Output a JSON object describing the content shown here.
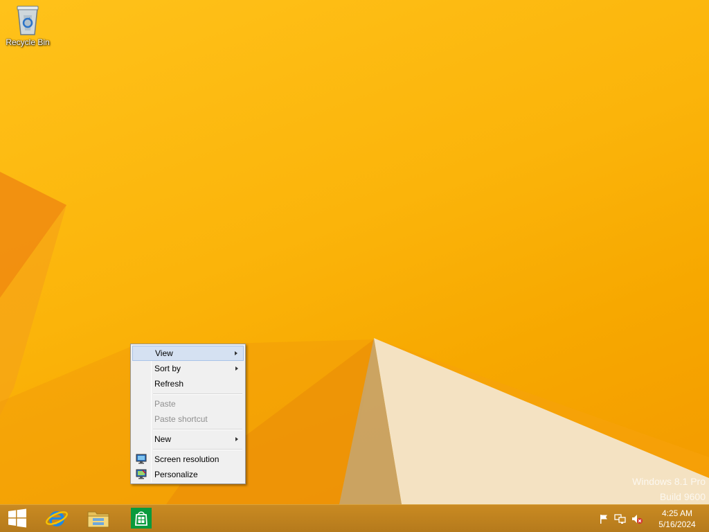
{
  "desktop": {
    "icons": [
      {
        "label": "Recycle Bin",
        "icon": "recycle-bin-icon"
      }
    ],
    "watermark": {
      "line1": "Windows 8.1 Pro",
      "line2": "Build 9600"
    }
  },
  "context_menu": {
    "items": [
      {
        "label": "View",
        "submenu": true,
        "highlighted": true
      },
      {
        "label": "Sort by",
        "submenu": true
      },
      {
        "label": "Refresh"
      },
      {
        "label": "Paste",
        "disabled": true
      },
      {
        "label": "Paste shortcut",
        "disabled": true
      },
      {
        "label": "New",
        "submenu": true
      },
      {
        "label": "Screen resolution",
        "icon": "display-settings-icon"
      },
      {
        "label": "Personalize",
        "icon": "personalize-icon"
      }
    ]
  },
  "taskbar": {
    "start": {
      "icon": "windows-start-icon"
    },
    "pinned": [
      {
        "name": "Internet Explorer",
        "icon": "internet-explorer-icon"
      },
      {
        "name": "File Explorer",
        "icon": "file-explorer-icon"
      },
      {
        "name": "Store",
        "icon": "store-icon"
      }
    ],
    "tray": {
      "icons": [
        "action-center-flag-icon",
        "network-icon",
        "volume-muted-icon"
      ],
      "time": "4:25 AM",
      "date": "5/16/2024"
    }
  },
  "colors": {
    "wallpaper": "#f6b800",
    "taskbar": "#c08420",
    "menu_highlight": "#d5e1f2"
  }
}
